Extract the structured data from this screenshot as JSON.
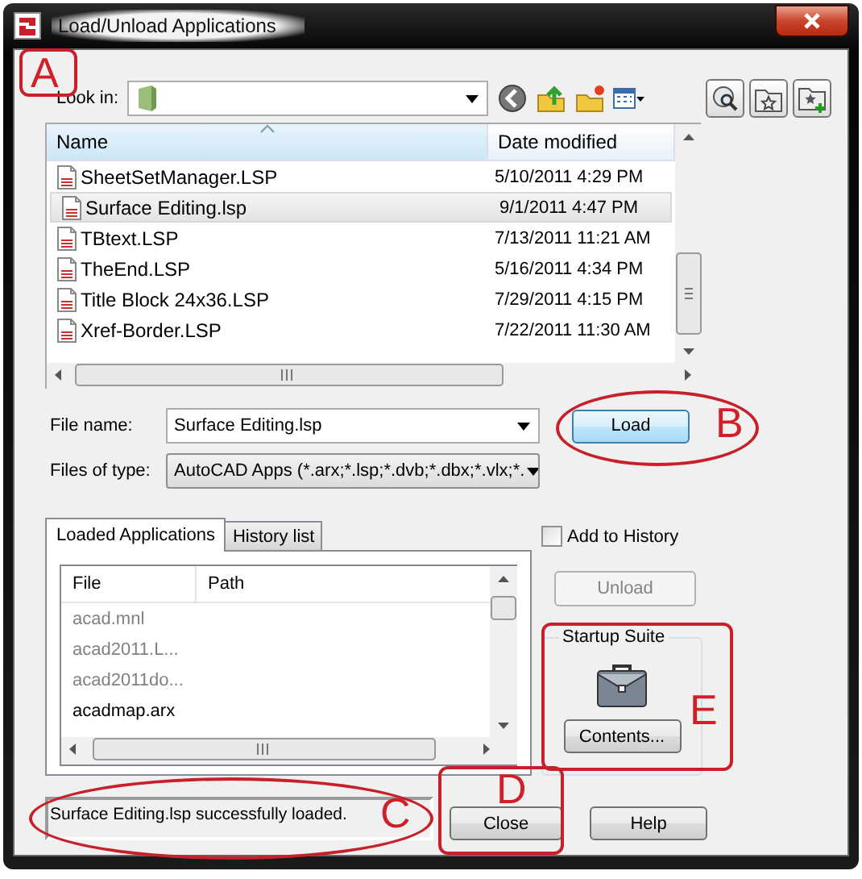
{
  "window": {
    "title": "Load/Unload Applications"
  },
  "look_in": {
    "label": "Look in:"
  },
  "file_list": {
    "columns": [
      {
        "label": "Name",
        "sorted": true
      },
      {
        "label": "Date modified",
        "sorted": false
      }
    ],
    "rows": [
      {
        "name": "SheetSetManager.LSP",
        "date": "5/10/2011 4:29 PM",
        "selected": false
      },
      {
        "name": "Surface Editing.lsp",
        "date": "9/1/2011 4:47 PM",
        "selected": true
      },
      {
        "name": "TBtext.LSP",
        "date": "7/13/2011 11:21 AM",
        "selected": false
      },
      {
        "name": "TheEnd.LSP",
        "date": "5/16/2011 4:34 PM",
        "selected": false
      },
      {
        "name": "Title Block 24x36.LSP",
        "date": "7/29/2011 4:15 PM",
        "selected": false
      },
      {
        "name": "Xref-Border.LSP",
        "date": "7/22/2011 11:30 AM",
        "selected": false
      }
    ]
  },
  "file_name": {
    "label": "File name:",
    "value": "Surface Editing.lsp"
  },
  "file_type": {
    "label": "Files of type:",
    "value": "AutoCAD Apps (*.arx;*.lsp;*.dvb;*.dbx;*.vlx;*."
  },
  "load_button": {
    "label": "Load"
  },
  "tabs": [
    {
      "label": "Loaded Applications",
      "selected": true
    },
    {
      "label": "History list",
      "selected": false
    }
  ],
  "loaded_list": {
    "columns": [
      "File",
      "Path"
    ],
    "rows": [
      {
        "file": "acad.mnl",
        "dimmed": true
      },
      {
        "file": "acad2011.L...",
        "dimmed": true
      },
      {
        "file": "acad2011do...",
        "dimmed": true
      },
      {
        "file": "acadmap.arx",
        "dimmed": false
      }
    ]
  },
  "add_to_history": {
    "label": "Add to History",
    "checked": false
  },
  "unload_button": {
    "label": "Unload",
    "disabled": true
  },
  "startup_suite": {
    "title": "Startup Suite",
    "button": "Contents..."
  },
  "status": "Surface Editing.lsp successfully loaded.",
  "buttons": [
    {
      "label": "Close"
    },
    {
      "label": "Help"
    }
  ],
  "annotations": [
    {
      "label": "A",
      "kind": "box"
    },
    {
      "label": "B",
      "kind": "oval"
    },
    {
      "label": "C",
      "kind": "oval"
    },
    {
      "label": "D",
      "kind": "box"
    },
    {
      "label": "E",
      "kind": "box"
    }
  ]
}
